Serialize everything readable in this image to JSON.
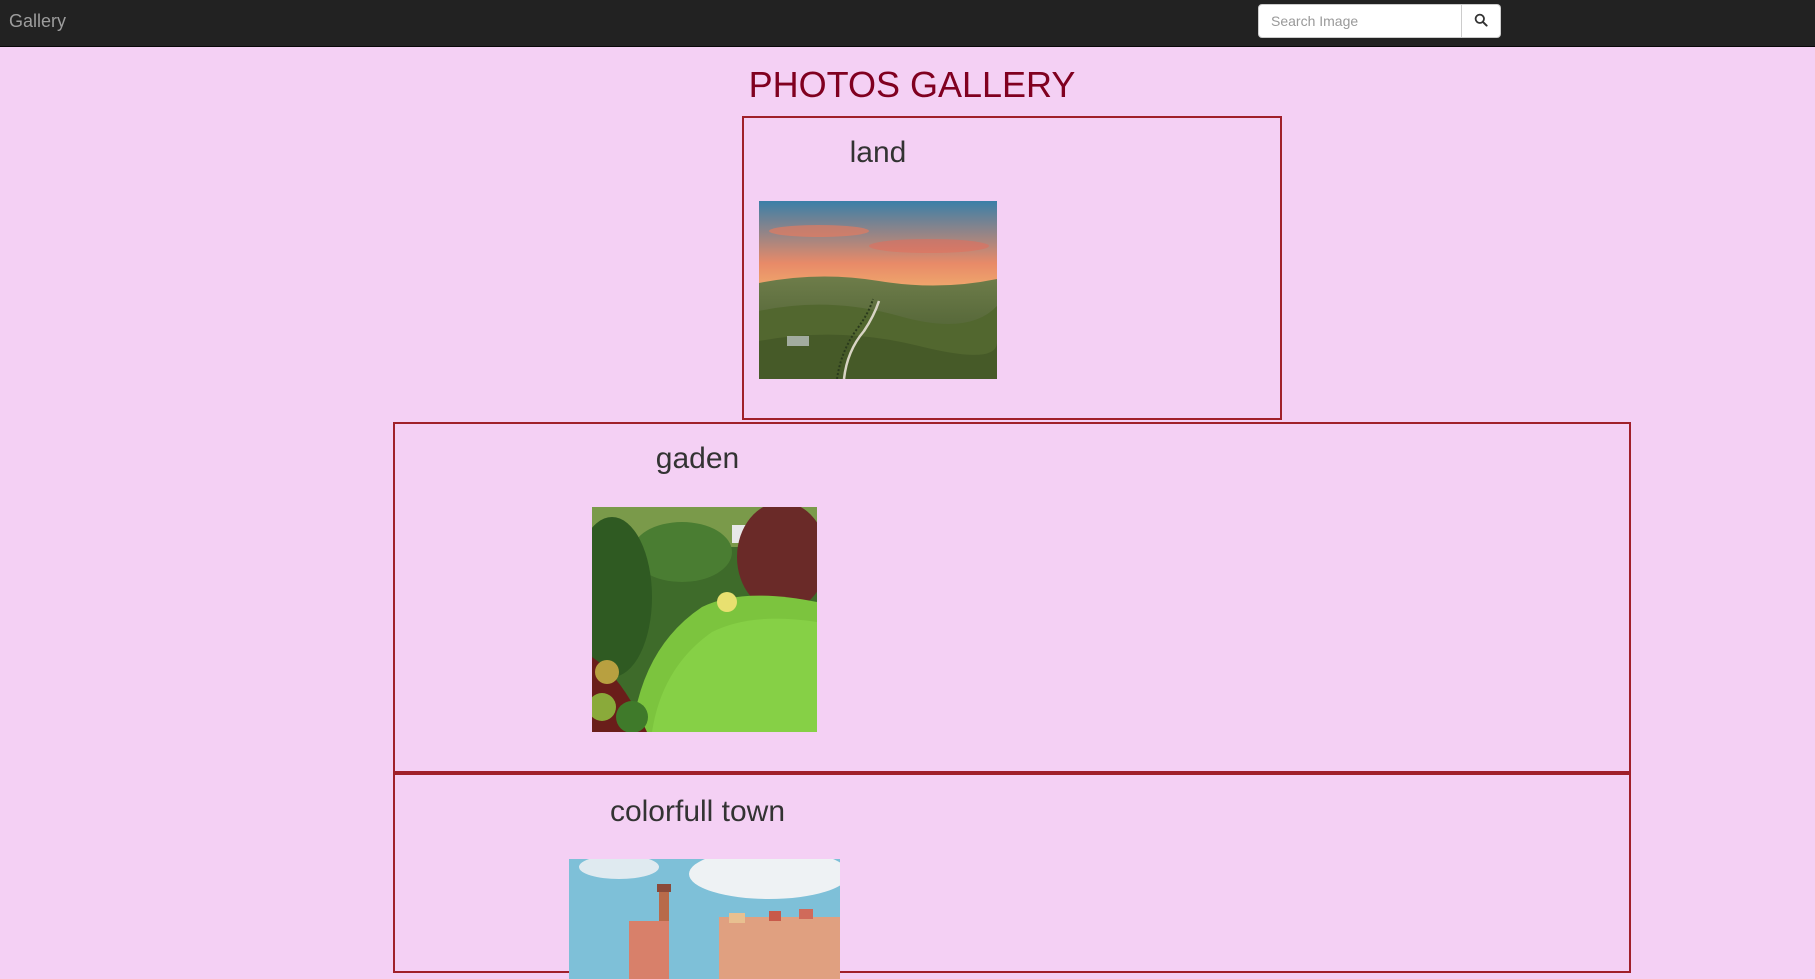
{
  "navbar": {
    "brand": "Gallery",
    "search": {
      "placeholder": "Search Image",
      "value": ""
    },
    "search_button_icon": "search-icon"
  },
  "page": {
    "title": "PHOTOS GALLERY"
  },
  "gallery": [
    {
      "title": "land",
      "image": "landscape-hills-sunset"
    },
    {
      "title": "gaden",
      "image": "garden-lawn"
    },
    {
      "title": "colorfull town",
      "image": "colorful-town"
    }
  ],
  "colors": {
    "background": "#f4d0f4",
    "navbar": "#222222",
    "title": "#800020",
    "card_border": "#a0202a"
  }
}
